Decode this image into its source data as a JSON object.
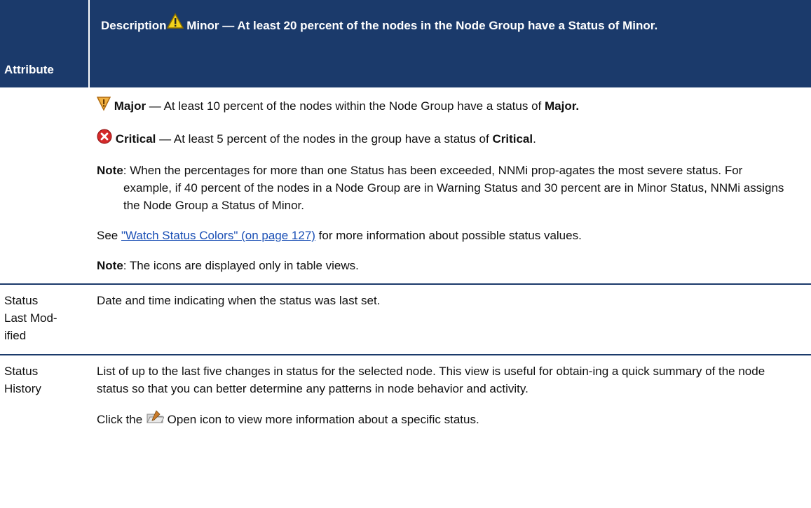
{
  "header": {
    "col_attribute": "Attribute",
    "col_description": "Description",
    "minor_label": "Minor",
    "minor_text": " — At least 20 percent of the nodes in the Node Group have a Status of Minor."
  },
  "status_row": {
    "major_label": "Major",
    "major_text": " — At least 10 percent of the nodes within the Node Group have a status of ",
    "major_end": "Major.",
    "critical_label": "Critical",
    "critical_text": " — At least 5 percent of the nodes in the group have a status of ",
    "critical_end": "Critical",
    "critical_period": ".",
    "note_label": "Note",
    "note_text": ": When the percentages for more than one Status has been exceeded, NNMi prop-agates the most severe status. For example, if 40 percent of the nodes in a Node Group are in Warning Status and 30 percent are in Minor Status, NNMi assigns the Node Group a Status of Minor.",
    "see_prefix": "See ",
    "see_link": "\"Watch Status Colors\" (on page 127)",
    "see_suffix": " for more information about possible status values.",
    "note2_label": "Note",
    "note2_text": ": The icons are displayed only in table views."
  },
  "rows": [
    {
      "attribute_line1": "Status",
      "attribute_line2": "Last Mod-",
      "attribute_line3": "ified",
      "description": "Date and time indicating when the status was last set."
    },
    {
      "attribute_line1": "Status",
      "attribute_line2": "History",
      "description": "List of up to the last five changes in status for the selected node. This view is useful for obtain-ing a quick summary of the node status so that you can better determine any patterns in node behavior and activity.",
      "click_prefix": "Click the ",
      "click_suffix": " Open icon to view more information about a specific status."
    }
  ],
  "icons": [
    "warning-triangle-icon",
    "major-triangle-icon",
    "critical-x-icon",
    "open-icon"
  ],
  "colors": {
    "header_bg": "#1b3a6b",
    "link": "#1a4fb5",
    "minor_yellow": "#f2d21b",
    "major_orange": "#f0a030",
    "critical_red": "#d42a2a"
  }
}
